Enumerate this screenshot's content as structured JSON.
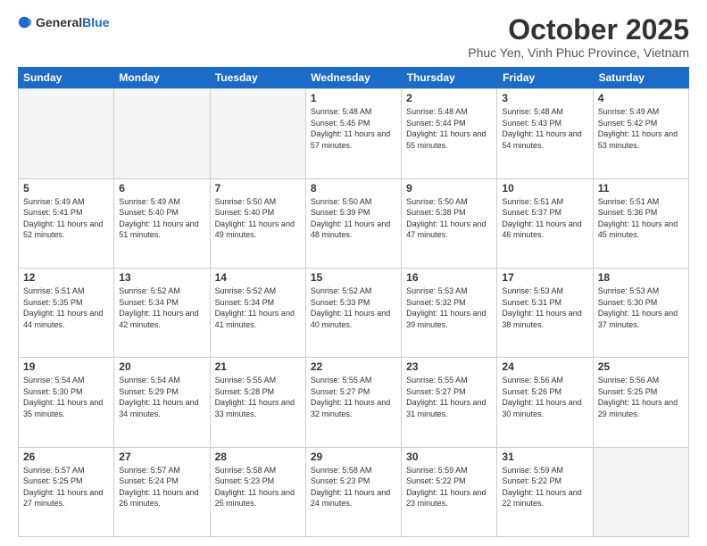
{
  "logo": {
    "general": "General",
    "blue": "Blue"
  },
  "header": {
    "month": "October 2025",
    "location": "Phuc Yen, Vinh Phuc Province, Vietnam"
  },
  "days": [
    "Sunday",
    "Monday",
    "Tuesday",
    "Wednesday",
    "Thursday",
    "Friday",
    "Saturday"
  ],
  "weeks": [
    [
      {
        "day": "",
        "empty": true
      },
      {
        "day": "",
        "empty": true
      },
      {
        "day": "",
        "empty": true
      },
      {
        "day": "1",
        "sunrise": "5:48 AM",
        "sunset": "5:45 PM",
        "daylight": "11 hours and 57 minutes."
      },
      {
        "day": "2",
        "sunrise": "5:48 AM",
        "sunset": "5:44 PM",
        "daylight": "11 hours and 55 minutes."
      },
      {
        "day": "3",
        "sunrise": "5:48 AM",
        "sunset": "5:43 PM",
        "daylight": "11 hours and 54 minutes."
      },
      {
        "day": "4",
        "sunrise": "5:49 AM",
        "sunset": "5:42 PM",
        "daylight": "11 hours and 53 minutes."
      }
    ],
    [
      {
        "day": "5",
        "sunrise": "5:49 AM",
        "sunset": "5:41 PM",
        "daylight": "11 hours and 52 minutes."
      },
      {
        "day": "6",
        "sunrise": "5:49 AM",
        "sunset": "5:40 PM",
        "daylight": "11 hours and 51 minutes."
      },
      {
        "day": "7",
        "sunrise": "5:50 AM",
        "sunset": "5:40 PM",
        "daylight": "11 hours and 49 minutes."
      },
      {
        "day": "8",
        "sunrise": "5:50 AM",
        "sunset": "5:39 PM",
        "daylight": "11 hours and 48 minutes."
      },
      {
        "day": "9",
        "sunrise": "5:50 AM",
        "sunset": "5:38 PM",
        "daylight": "11 hours and 47 minutes."
      },
      {
        "day": "10",
        "sunrise": "5:51 AM",
        "sunset": "5:37 PM",
        "daylight": "11 hours and 46 minutes."
      },
      {
        "day": "11",
        "sunrise": "5:51 AM",
        "sunset": "5:36 PM",
        "daylight": "11 hours and 45 minutes."
      }
    ],
    [
      {
        "day": "12",
        "sunrise": "5:51 AM",
        "sunset": "5:35 PM",
        "daylight": "11 hours and 44 minutes."
      },
      {
        "day": "13",
        "sunrise": "5:52 AM",
        "sunset": "5:34 PM",
        "daylight": "11 hours and 42 minutes."
      },
      {
        "day": "14",
        "sunrise": "5:52 AM",
        "sunset": "5:34 PM",
        "daylight": "11 hours and 41 minutes."
      },
      {
        "day": "15",
        "sunrise": "5:52 AM",
        "sunset": "5:33 PM",
        "daylight": "11 hours and 40 minutes."
      },
      {
        "day": "16",
        "sunrise": "5:53 AM",
        "sunset": "5:32 PM",
        "daylight": "11 hours and 39 minutes."
      },
      {
        "day": "17",
        "sunrise": "5:53 AM",
        "sunset": "5:31 PM",
        "daylight": "11 hours and 38 minutes."
      },
      {
        "day": "18",
        "sunrise": "5:53 AM",
        "sunset": "5:30 PM",
        "daylight": "11 hours and 37 minutes."
      }
    ],
    [
      {
        "day": "19",
        "sunrise": "5:54 AM",
        "sunset": "5:30 PM",
        "daylight": "11 hours and 35 minutes."
      },
      {
        "day": "20",
        "sunrise": "5:54 AM",
        "sunset": "5:29 PM",
        "daylight": "11 hours and 34 minutes."
      },
      {
        "day": "21",
        "sunrise": "5:55 AM",
        "sunset": "5:28 PM",
        "daylight": "11 hours and 33 minutes."
      },
      {
        "day": "22",
        "sunrise": "5:55 AM",
        "sunset": "5:27 PM",
        "daylight": "11 hours and 32 minutes."
      },
      {
        "day": "23",
        "sunrise": "5:55 AM",
        "sunset": "5:27 PM",
        "daylight": "11 hours and 31 minutes."
      },
      {
        "day": "24",
        "sunrise": "5:56 AM",
        "sunset": "5:26 PM",
        "daylight": "11 hours and 30 minutes."
      },
      {
        "day": "25",
        "sunrise": "5:56 AM",
        "sunset": "5:25 PM",
        "daylight": "11 hours and 29 minutes."
      }
    ],
    [
      {
        "day": "26",
        "sunrise": "5:57 AM",
        "sunset": "5:25 PM",
        "daylight": "11 hours and 27 minutes."
      },
      {
        "day": "27",
        "sunrise": "5:57 AM",
        "sunset": "5:24 PM",
        "daylight": "11 hours and 26 minutes."
      },
      {
        "day": "28",
        "sunrise": "5:58 AM",
        "sunset": "5:23 PM",
        "daylight": "11 hours and 25 minutes."
      },
      {
        "day": "29",
        "sunrise": "5:58 AM",
        "sunset": "5:23 PM",
        "daylight": "11 hours and 24 minutes."
      },
      {
        "day": "30",
        "sunrise": "5:59 AM",
        "sunset": "5:22 PM",
        "daylight": "11 hours and 23 minutes."
      },
      {
        "day": "31",
        "sunrise": "5:59 AM",
        "sunset": "5:22 PM",
        "daylight": "11 hours and 22 minutes."
      },
      {
        "day": "",
        "empty": true
      }
    ]
  ]
}
